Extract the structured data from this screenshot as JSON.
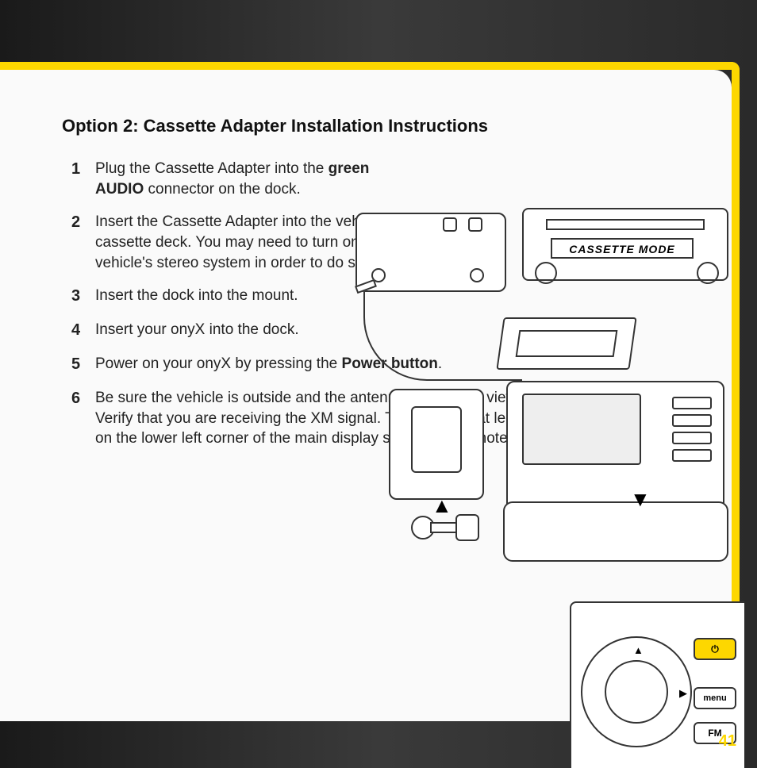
{
  "page_number": "41",
  "heading": "Option 2: Cassette Adapter Installation Instructions",
  "stereo_display": "CASSETTE MODE",
  "steps": [
    {
      "n": "1",
      "pre": "Plug the Cassette Adapter into the ",
      "bold": "green AUDIO",
      "post": " connector on the dock."
    },
    {
      "n": "2",
      "text": "Insert the Cassette Adapter into the vehicle's cassette deck. You may need to turn on your vehicle's stereo system in order to do so."
    },
    {
      "n": "3",
      "text": "Insert the dock into the mount."
    },
    {
      "n": "4",
      "text": "Insert your onyX into the dock."
    },
    {
      "n": "5",
      "pre": "Power on your onyX by pressing the ",
      "bold": "Power button",
      "post": "."
    },
    {
      "n": "6",
      "text": "Be sure the vehicle is outside and the antenna has a clear view of the sky. Verify that you are receiving the XM signal. There should at least be one bar on the lower left corner of the main display screen that denotes antenna signal"
    }
  ],
  "control_buttons": {
    "power": "⏻",
    "menu": "menu",
    "fm": "FM"
  }
}
